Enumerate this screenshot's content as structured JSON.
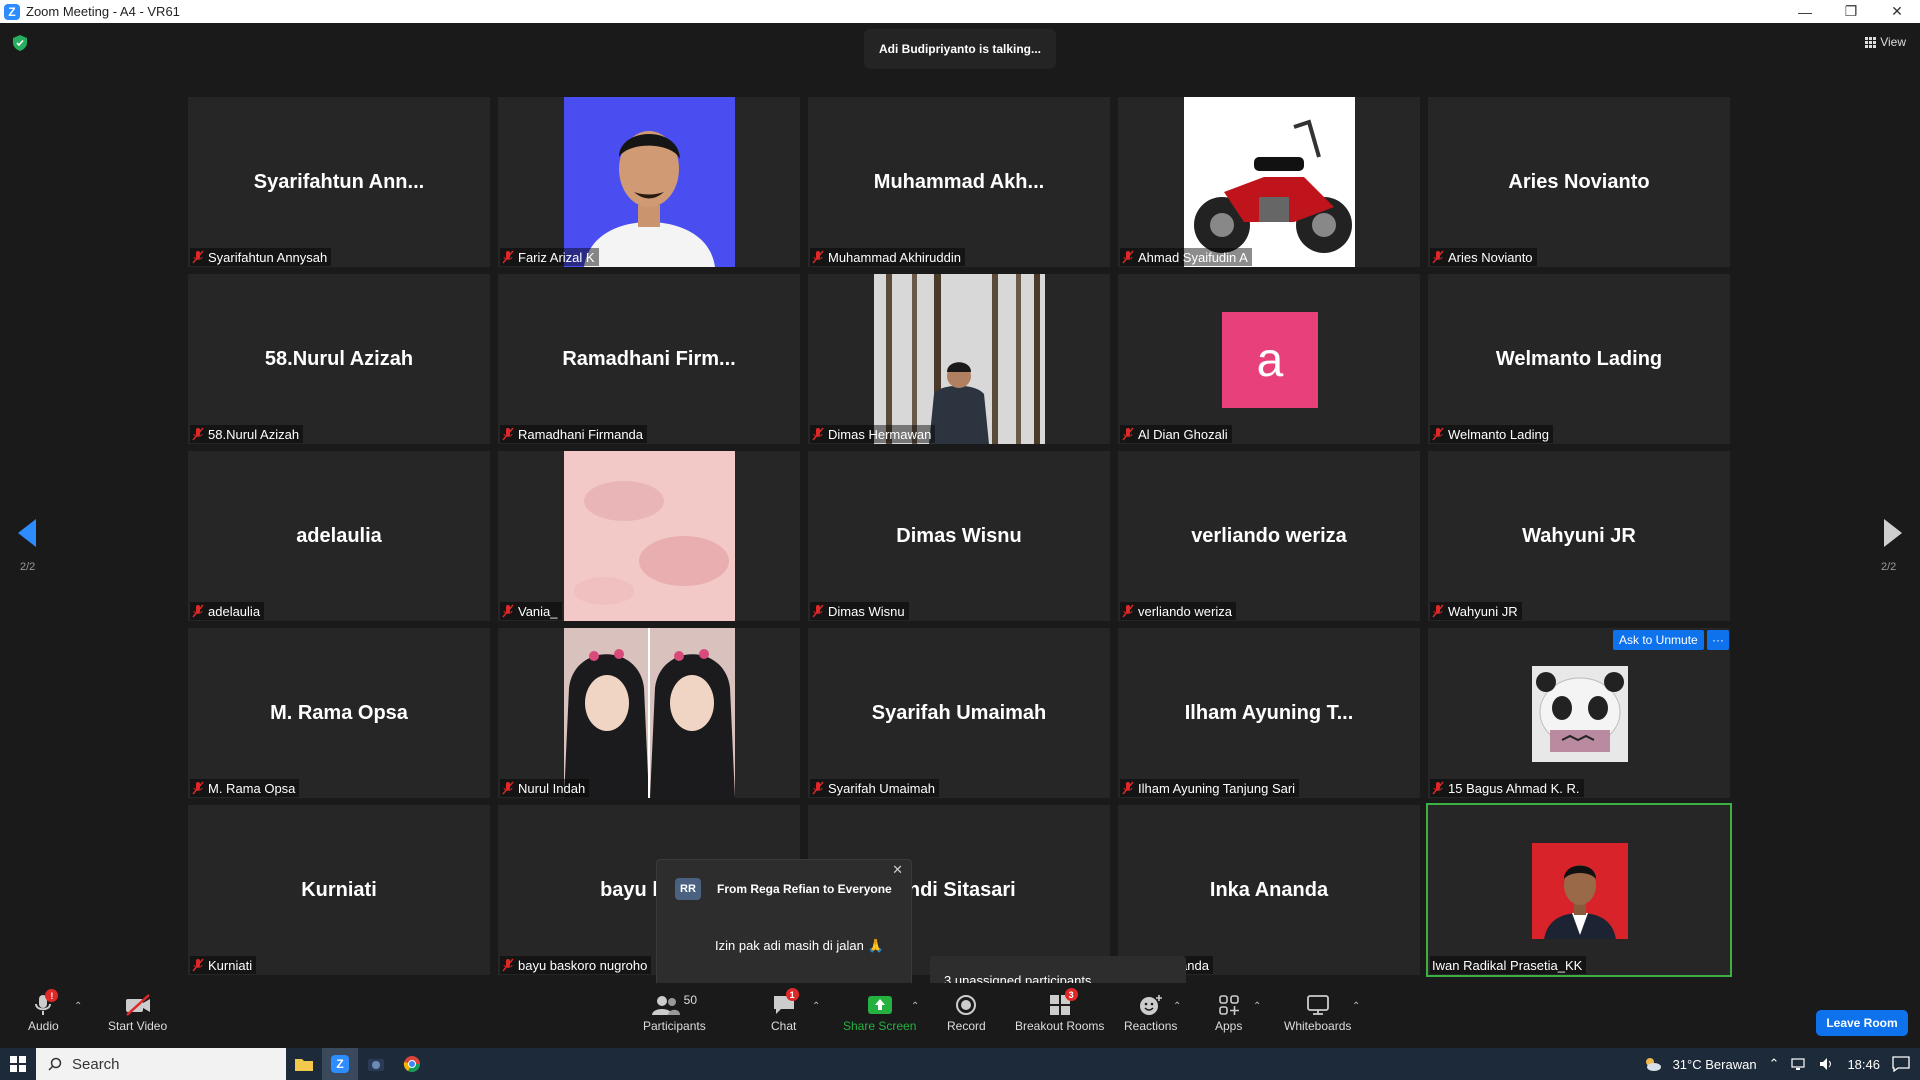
{
  "window": {
    "title": "Zoom Meeting - A4 - VR61",
    "logo": "Z",
    "controls": [
      "minimize-icon",
      "restore-icon",
      "close-icon"
    ]
  },
  "meeting": {
    "talking_banner": "Adi Budipriyanto is talking...",
    "view_label": "View",
    "page_left": "2/2",
    "page_right": "2/2",
    "ask_to_unmute": "Ask to Unmute",
    "more_label": "···"
  },
  "tiles": [
    {
      "big": "Syarifahtun  Ann...",
      "label": "Syarifahtun Annysah",
      "kind": "name"
    },
    {
      "big": "",
      "label": "Fariz Arizal K",
      "kind": "photo-man-blue"
    },
    {
      "big": "Muhammad  Akh...",
      "label": "Muhammad Akhiruddin",
      "kind": "name"
    },
    {
      "big": "",
      "label": "Ahmad Syaifudin A",
      "kind": "photo-motorbike"
    },
    {
      "big": "Aries Novianto",
      "label": "Aries Novianto",
      "kind": "name"
    },
    {
      "big": "58.Nurul Azizah",
      "label": "58.Nurul Azizah",
      "kind": "name"
    },
    {
      "big": "Ramadhani  Firm...",
      "label": "Ramadhani Firmanda",
      "kind": "name"
    },
    {
      "big": "",
      "label": "Dimas Hermawan",
      "kind": "photo-forest"
    },
    {
      "big": "a",
      "label": "Al Dian Ghozali",
      "kind": "letter"
    },
    {
      "big": "Welmanto Lading",
      "label": "Welmanto Lading",
      "kind": "name"
    },
    {
      "big": "adelaulia",
      "label": "adelaulia",
      "kind": "name"
    },
    {
      "big": "",
      "label": "Vania_",
      "kind": "photo-pink"
    },
    {
      "big": "Dimas Wisnu",
      "label": "Dimas Wisnu",
      "kind": "name"
    },
    {
      "big": "verliando weriza",
      "label": "verliando weriza",
      "kind": "name"
    },
    {
      "big": "Wahyuni JR",
      "label": "Wahyuni JR",
      "kind": "name"
    },
    {
      "big": "M. Rama Opsa",
      "label": "M. Rama Opsa",
      "kind": "name"
    },
    {
      "big": "",
      "label": "Nurul Indah",
      "kind": "photo-hijab"
    },
    {
      "big": "Syarifah Umaimah",
      "label": "Syarifah Umaimah",
      "kind": "name"
    },
    {
      "big": "Ilham Ayuning  T...",
      "label": "Ilham Ayuning Tanjung Sari",
      "kind": "name"
    },
    {
      "big": "",
      "label": "15 Bagus Ahmad K. R.",
      "kind": "photo-panda"
    },
    {
      "big": "Kurniati",
      "label": "Kurniati",
      "kind": "name"
    },
    {
      "big": "bayu  bask",
      "label": "bayu baskoro nugroho",
      "kind": "name"
    },
    {
      "big": "indi Sitasari",
      "label": "",
      "kind": "name"
    },
    {
      "big": "Inka Ananda",
      "label": "anda",
      "kind": "name"
    },
    {
      "big": "",
      "label": "Iwan Radikal Prasetia_KK",
      "kind": "photo-man-red"
    }
  ],
  "chat_popup": {
    "avatar": "RR",
    "from": "From Rega Refian to Everyone",
    "message": "Izin pak adi masih di jalan 🙏",
    "close": "✕"
  },
  "unassigned": "3 unassigned participants",
  "toolbar": {
    "audio": "Audio",
    "start_video": "Start Video",
    "participants": "Participants",
    "participants_count": "50",
    "chat": "Chat",
    "chat_badge": "1",
    "share_screen": "Share Screen",
    "record": "Record",
    "breakout_rooms": "Breakout Rooms",
    "breakout_badge": "3",
    "reactions": "Reactions",
    "apps": "Apps",
    "whiteboards": "Whiteboards",
    "leave": "Leave Room",
    "audio_badge": "!"
  },
  "taskbar": {
    "search": "Search",
    "weather": "31°C  Berawan",
    "time": "18:46"
  },
  "colors": {
    "accent": "#0e72ed",
    "share_green": "#25b140",
    "letter_avatar": "#e8407a",
    "badge": "#e02828"
  }
}
